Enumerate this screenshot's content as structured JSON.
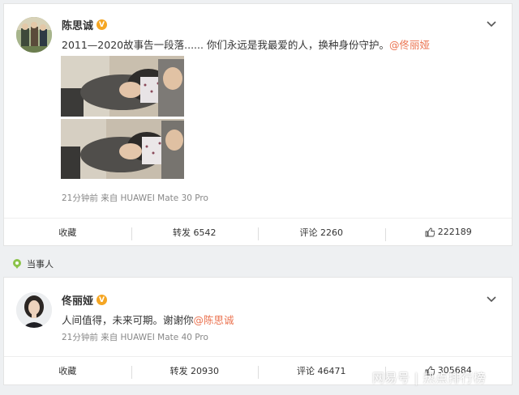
{
  "post1": {
    "author": "陈思诚",
    "verified_badge": "V",
    "text": "2011—2020故事告一段落...... 你们永远是我最爱的人，换种身份守护。",
    "mention": "@佟丽娅",
    "meta": "21分钟前  来自 HUAWEI Mate 30 Pro",
    "actions": {
      "collect": "收藏",
      "repost": "转发 6542",
      "comment": "评论 2260",
      "like": "222189"
    }
  },
  "section_label": "当事人",
  "post2": {
    "author": "佟丽娅",
    "verified_badge": "V",
    "text": "人间值得，未来可期。谢谢你",
    "mention": "@陈思诚",
    "meta": "21分钟前  来自 HUAWEI Mate 40 Pro",
    "actions": {
      "collect": "收藏",
      "repost": "转发 20930",
      "comment": "评论 46471",
      "like": "305684"
    }
  },
  "watermark": "网易号 | 热点排行榜",
  "icons": {
    "chevron": "chevron-down-icon",
    "like": "thumbs-up-icon",
    "section": "location-pin-icon"
  },
  "colors": {
    "mention": "#eb7350",
    "badge": "#f5a623",
    "section_icon": "#8bc34a"
  }
}
